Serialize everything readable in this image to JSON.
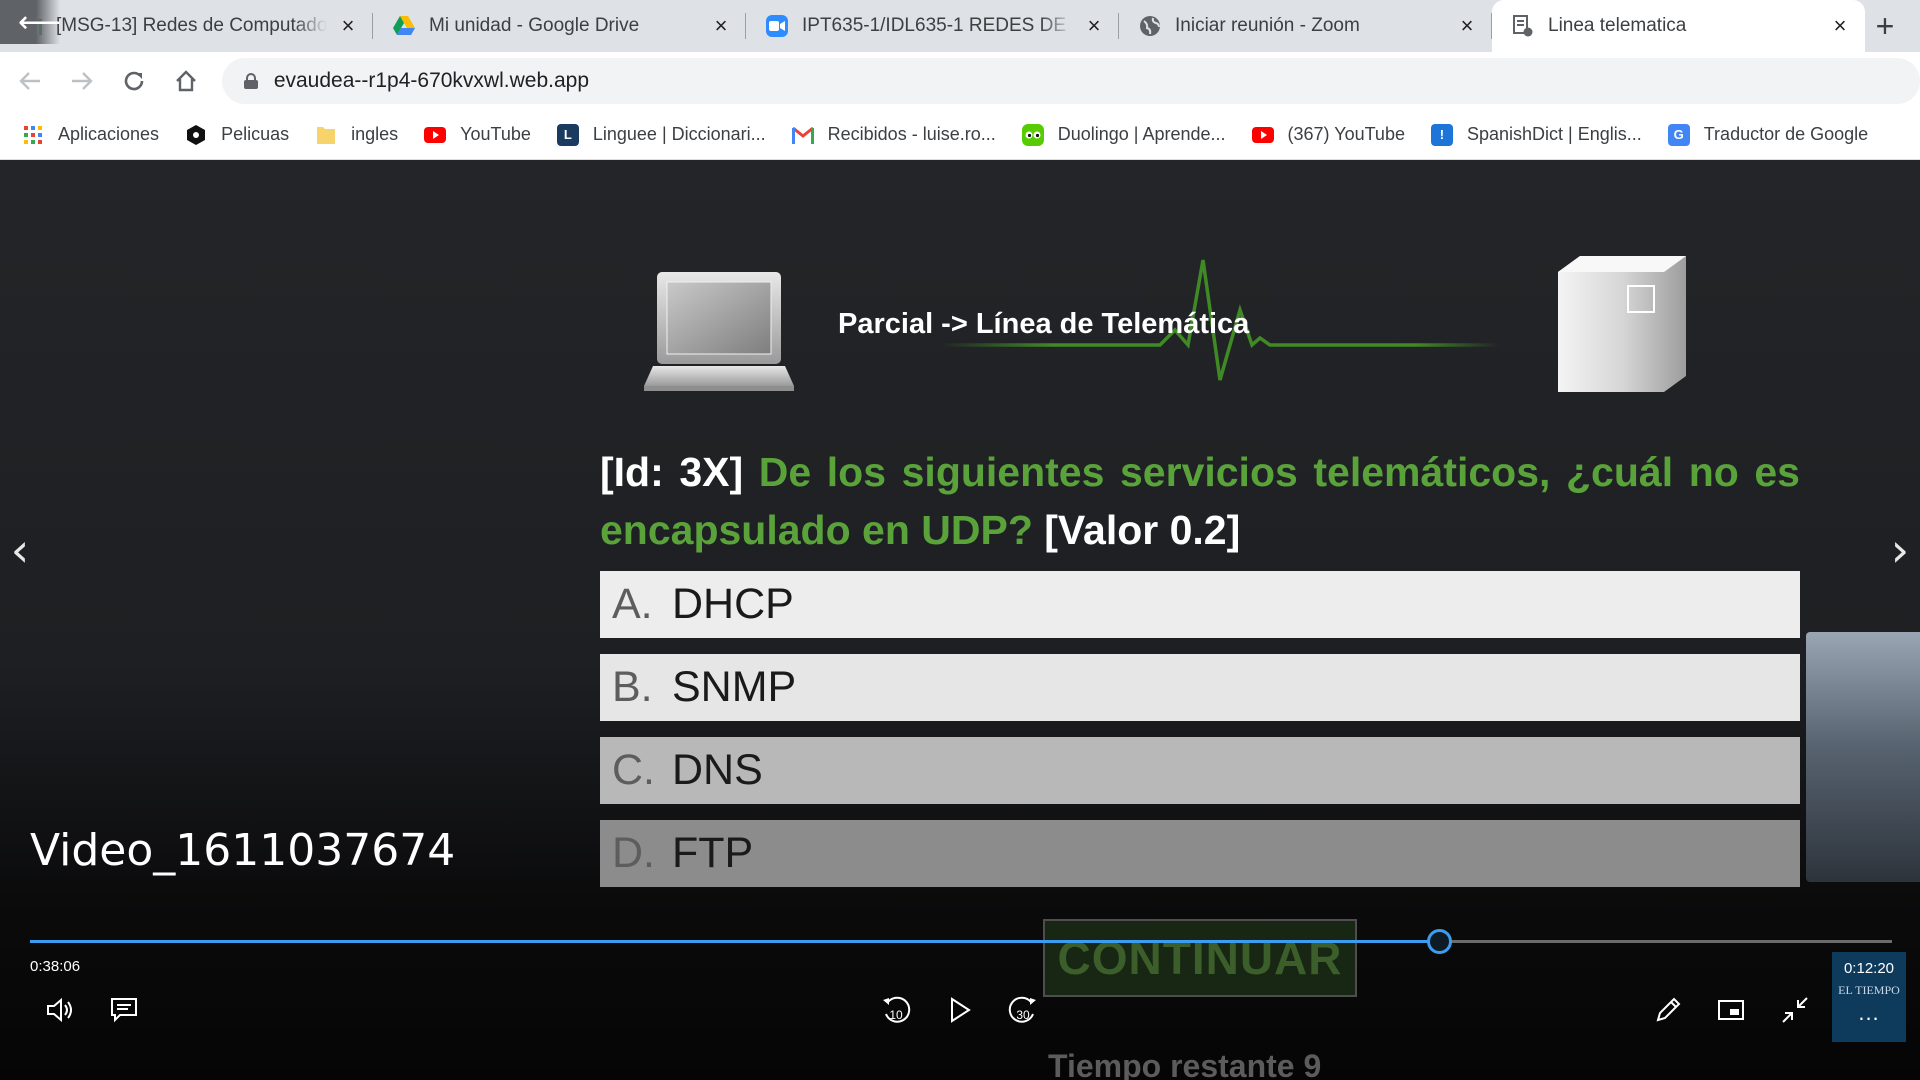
{
  "browser": {
    "tabs": [
      {
        "title": "[MSG-13] Redes de Computadores",
        "icon": "gmail-icon",
        "active": false
      },
      {
        "title": "Mi unidad - Google Drive",
        "icon": "google-drive-icon",
        "active": false
      },
      {
        "title": "IPT635-1/IDL635-1 REDES DE COMPUTADORES",
        "icon": "zoom-icon",
        "active": false
      },
      {
        "title": "Iniciar reunión - Zoom",
        "icon": "globe-icon",
        "active": false
      },
      {
        "title": "Linea telematica",
        "icon": "document-icon",
        "active": true
      }
    ],
    "url": "evaudea--r1p4-670kvxwl.web.app",
    "bookmarks": [
      {
        "label": "Aplicaciones",
        "icon": "apps-grid-icon"
      },
      {
        "label": "Pelicuas",
        "icon": "movie-icon"
      },
      {
        "label": "ingles",
        "icon": "folder-icon"
      },
      {
        "label": "YouTube",
        "icon": "youtube-icon"
      },
      {
        "label": "Linguee | Diccionari...",
        "icon": "linguee-icon"
      },
      {
        "label": "Recibidos - luise.ro...",
        "icon": "gmail-icon"
      },
      {
        "label": "Duolingo | Aprende...",
        "icon": "duolingo-icon"
      },
      {
        "label": "(367) YouTube",
        "icon": "youtube-icon"
      },
      {
        "label": "SpanishDict | Englis...",
        "icon": "spanishdict-icon"
      },
      {
        "label": "Traductor de Google",
        "icon": "google-translate-icon"
      }
    ]
  },
  "quiz": {
    "banner_title": "Parcial -> Línea de Telemática",
    "question_id": "[Id: 3X]",
    "question_text": "De los siguientes servicios telemáticos, ¿cuál no es encapsulado en UDP?",
    "question_value": "[Valor 0.2]",
    "options": [
      {
        "letter": "A.",
        "text": "DHCP"
      },
      {
        "letter": "B.",
        "text": "SNMP"
      },
      {
        "letter": "C.",
        "text": "DNS"
      },
      {
        "letter": "D.",
        "text": "FTP"
      }
    ],
    "continue_label": "CONTINUAR",
    "remaining_label": "Tiempo restante 9"
  },
  "player": {
    "video_title": "Video_1611037674",
    "elapsed": "0:38:06",
    "remaining": "0:12:20",
    "remaining_caption": "EL TIEMPO",
    "progress_fraction": 0.7565,
    "more_label": "...",
    "rewind_label": "10",
    "forward_label": "30"
  }
}
